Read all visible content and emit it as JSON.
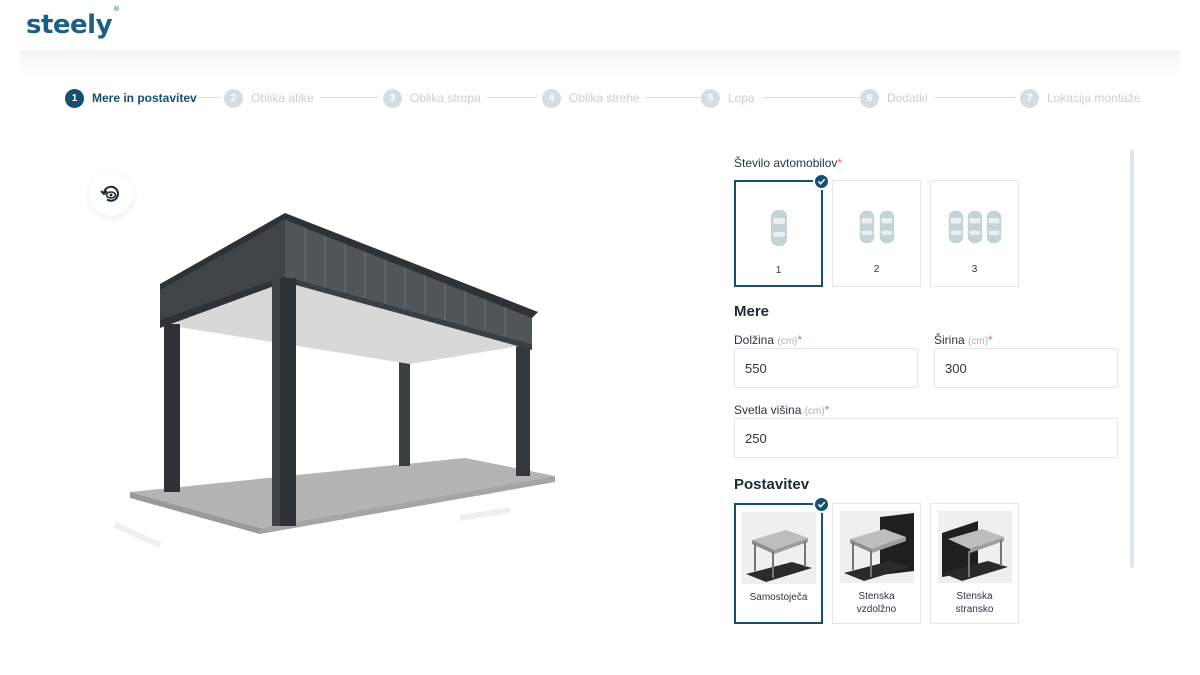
{
  "brand": {
    "logo": "steely",
    "mark": "®"
  },
  "steps": [
    {
      "num": "1",
      "label": "Mere in postavitev",
      "active": true
    },
    {
      "num": "2",
      "label": "Oblika atike",
      "active": false
    },
    {
      "num": "3",
      "label": "Oblika stropa",
      "active": false
    },
    {
      "num": "4",
      "label": "Oblika strehe",
      "active": false
    },
    {
      "num": "5",
      "label": "Lopa",
      "active": false
    },
    {
      "num": "6",
      "label": "Dodatki",
      "active": false
    },
    {
      "num": "7",
      "label": "Lokacija montaže",
      "active": false
    }
  ],
  "cars": {
    "label": "Število avtomobilov",
    "required": "*",
    "options": [
      {
        "label": "1",
        "selected": true
      },
      {
        "label": "2",
        "selected": false
      },
      {
        "label": "3",
        "selected": false
      }
    ]
  },
  "dimensions": {
    "title": "Mere",
    "length": {
      "label": "Dolžina",
      "unit": "(cm)",
      "required": "*",
      "value": "550"
    },
    "width": {
      "label": "Širina",
      "unit": "(cm)",
      "required": "*",
      "value": "300"
    },
    "height": {
      "label": "Svetla višina",
      "unit": "(cm)",
      "required": "*",
      "value": "250"
    }
  },
  "placement": {
    "title": "Postavitev",
    "options": [
      {
        "label_line1": "Samostoječa",
        "label_line2": "",
        "selected": true
      },
      {
        "label_line1": "Stenska",
        "label_line2": "vzdolžno",
        "selected": false
      },
      {
        "label_line1": "Stenska",
        "label_line2": "stransko",
        "selected": false
      }
    ]
  },
  "colors": {
    "accent": "#17506f",
    "logo": "#1b5f86",
    "structure": "#3a3f44",
    "floor": "#b8b8b8",
    "car_icon": "#c5d3d6",
    "required": "#e46a6a"
  },
  "icons": {
    "rotate": "rotate-view-icon",
    "check": "check-icon",
    "car": "car-icon"
  }
}
